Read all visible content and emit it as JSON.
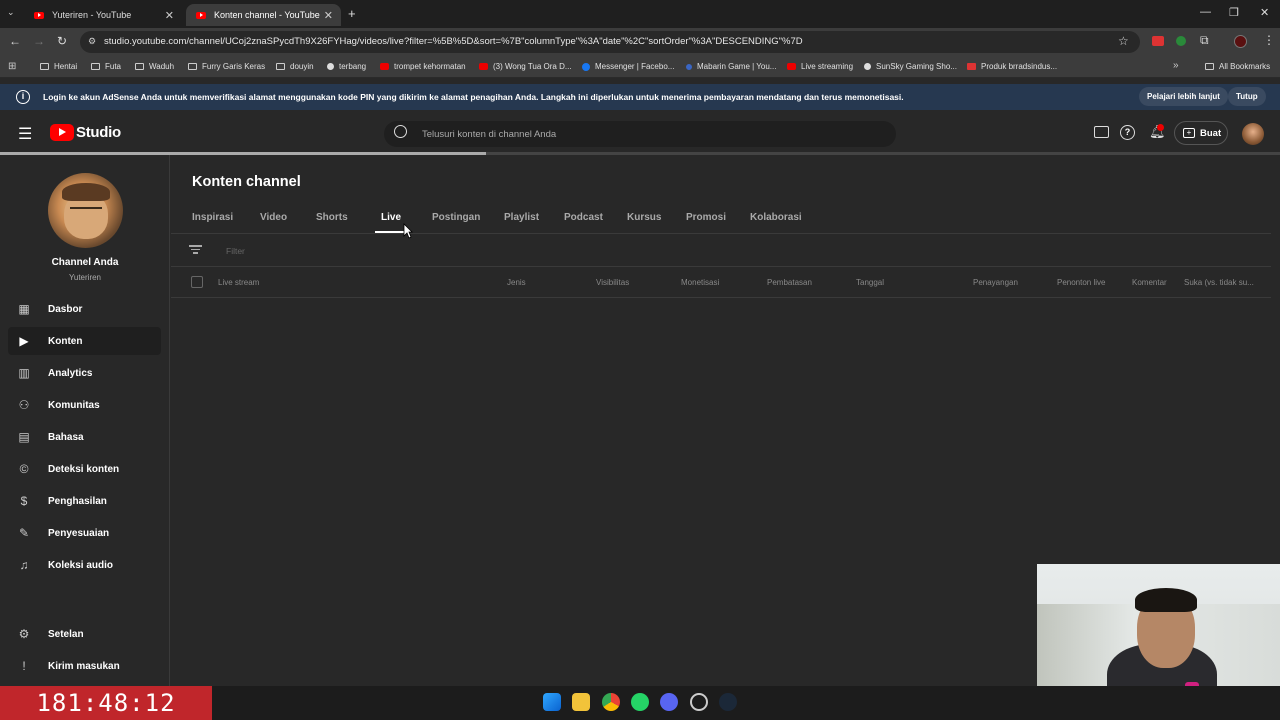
{
  "browser": {
    "tabs": [
      {
        "title": "Yuteriren - YouTube",
        "active": false
      },
      {
        "title": "Konten channel - YouTube Studi",
        "active": true
      }
    ],
    "url": "studio.youtube.com/channel/UCoj2znaSPycdTh9X26FYHag/videos/live?filter=%5B%5D&sort=%7B\"columnType\"%3A\"date\"%2C\"sortOrder\"%3A\"DESCENDING\"%7D",
    "bookmarks": [
      "Hentai",
      "Futa",
      "Waduh",
      "Furry Garis Keras",
      "douyin",
      "terbang",
      "trompet kehormatan",
      "(3) Wong Tua Ora D...",
      "Messenger | Facebo...",
      "Mabarin Game | You...",
      "Live streaming",
      "SunSky Gaming Sho...",
      "Produk brradsindus..."
    ],
    "all_bookmarks": "All Bookmarks",
    "chevron": "»"
  },
  "banner": {
    "text": "Login ke akun AdSense Anda untuk memverifikasi alamat menggunakan kode PIN yang dikirim ke alamat penagihan Anda. Langkah ini diperlukan untuk menerima pembayaran mendatang dan terus memonetisasi.",
    "learn_more": "Pelajari lebih lanjut",
    "close": "Tutup"
  },
  "header": {
    "logo": "Studio",
    "search_placeholder": "Telusuri konten di channel Anda",
    "create": "Buat"
  },
  "page": {
    "load_progress": 0.38
  },
  "sidebar": {
    "channel_title": "Channel Anda",
    "channel_name": "Yuteriren",
    "items": [
      {
        "label": "Dasbor",
        "icon": "dashboard-icon"
      },
      {
        "label": "Konten",
        "icon": "content-icon",
        "active": true
      },
      {
        "label": "Analytics",
        "icon": "analytics-icon"
      },
      {
        "label": "Komunitas",
        "icon": "community-icon"
      },
      {
        "label": "Bahasa",
        "icon": "language-icon"
      },
      {
        "label": "Deteksi konten",
        "icon": "copyright-icon"
      },
      {
        "label": "Penghasilan",
        "icon": "earn-icon"
      },
      {
        "label": "Penyesuaian",
        "icon": "customization-icon"
      },
      {
        "label": "Koleksi audio",
        "icon": "audio-library-icon"
      }
    ],
    "bottom": [
      {
        "label": "Setelan",
        "icon": "settings-icon"
      },
      {
        "label": "Kirim masukan",
        "icon": "feedback-icon"
      }
    ]
  },
  "content": {
    "title": "Konten channel",
    "tabs": [
      "Inspirasi",
      "Video",
      "Shorts",
      "Live",
      "Postingan",
      "Playlist",
      "Podcast",
      "Kursus",
      "Promosi",
      "Kolaborasi"
    ],
    "active_tab": "Live",
    "filter_placeholder": "Filter",
    "columns": [
      "Live stream",
      "Jenis",
      "Visibilitas",
      "Monetisasi",
      "Pembatasan",
      "Tanggal",
      "Penayangan",
      "Penonton live",
      "Komentar",
      "Suka (vs. tidak su..."
    ]
  },
  "timer": "181:48:12",
  "colors": {
    "youtube_red": "#ff0000",
    "banner_bg": "#263850",
    "timer_bg": "#c0262b"
  }
}
